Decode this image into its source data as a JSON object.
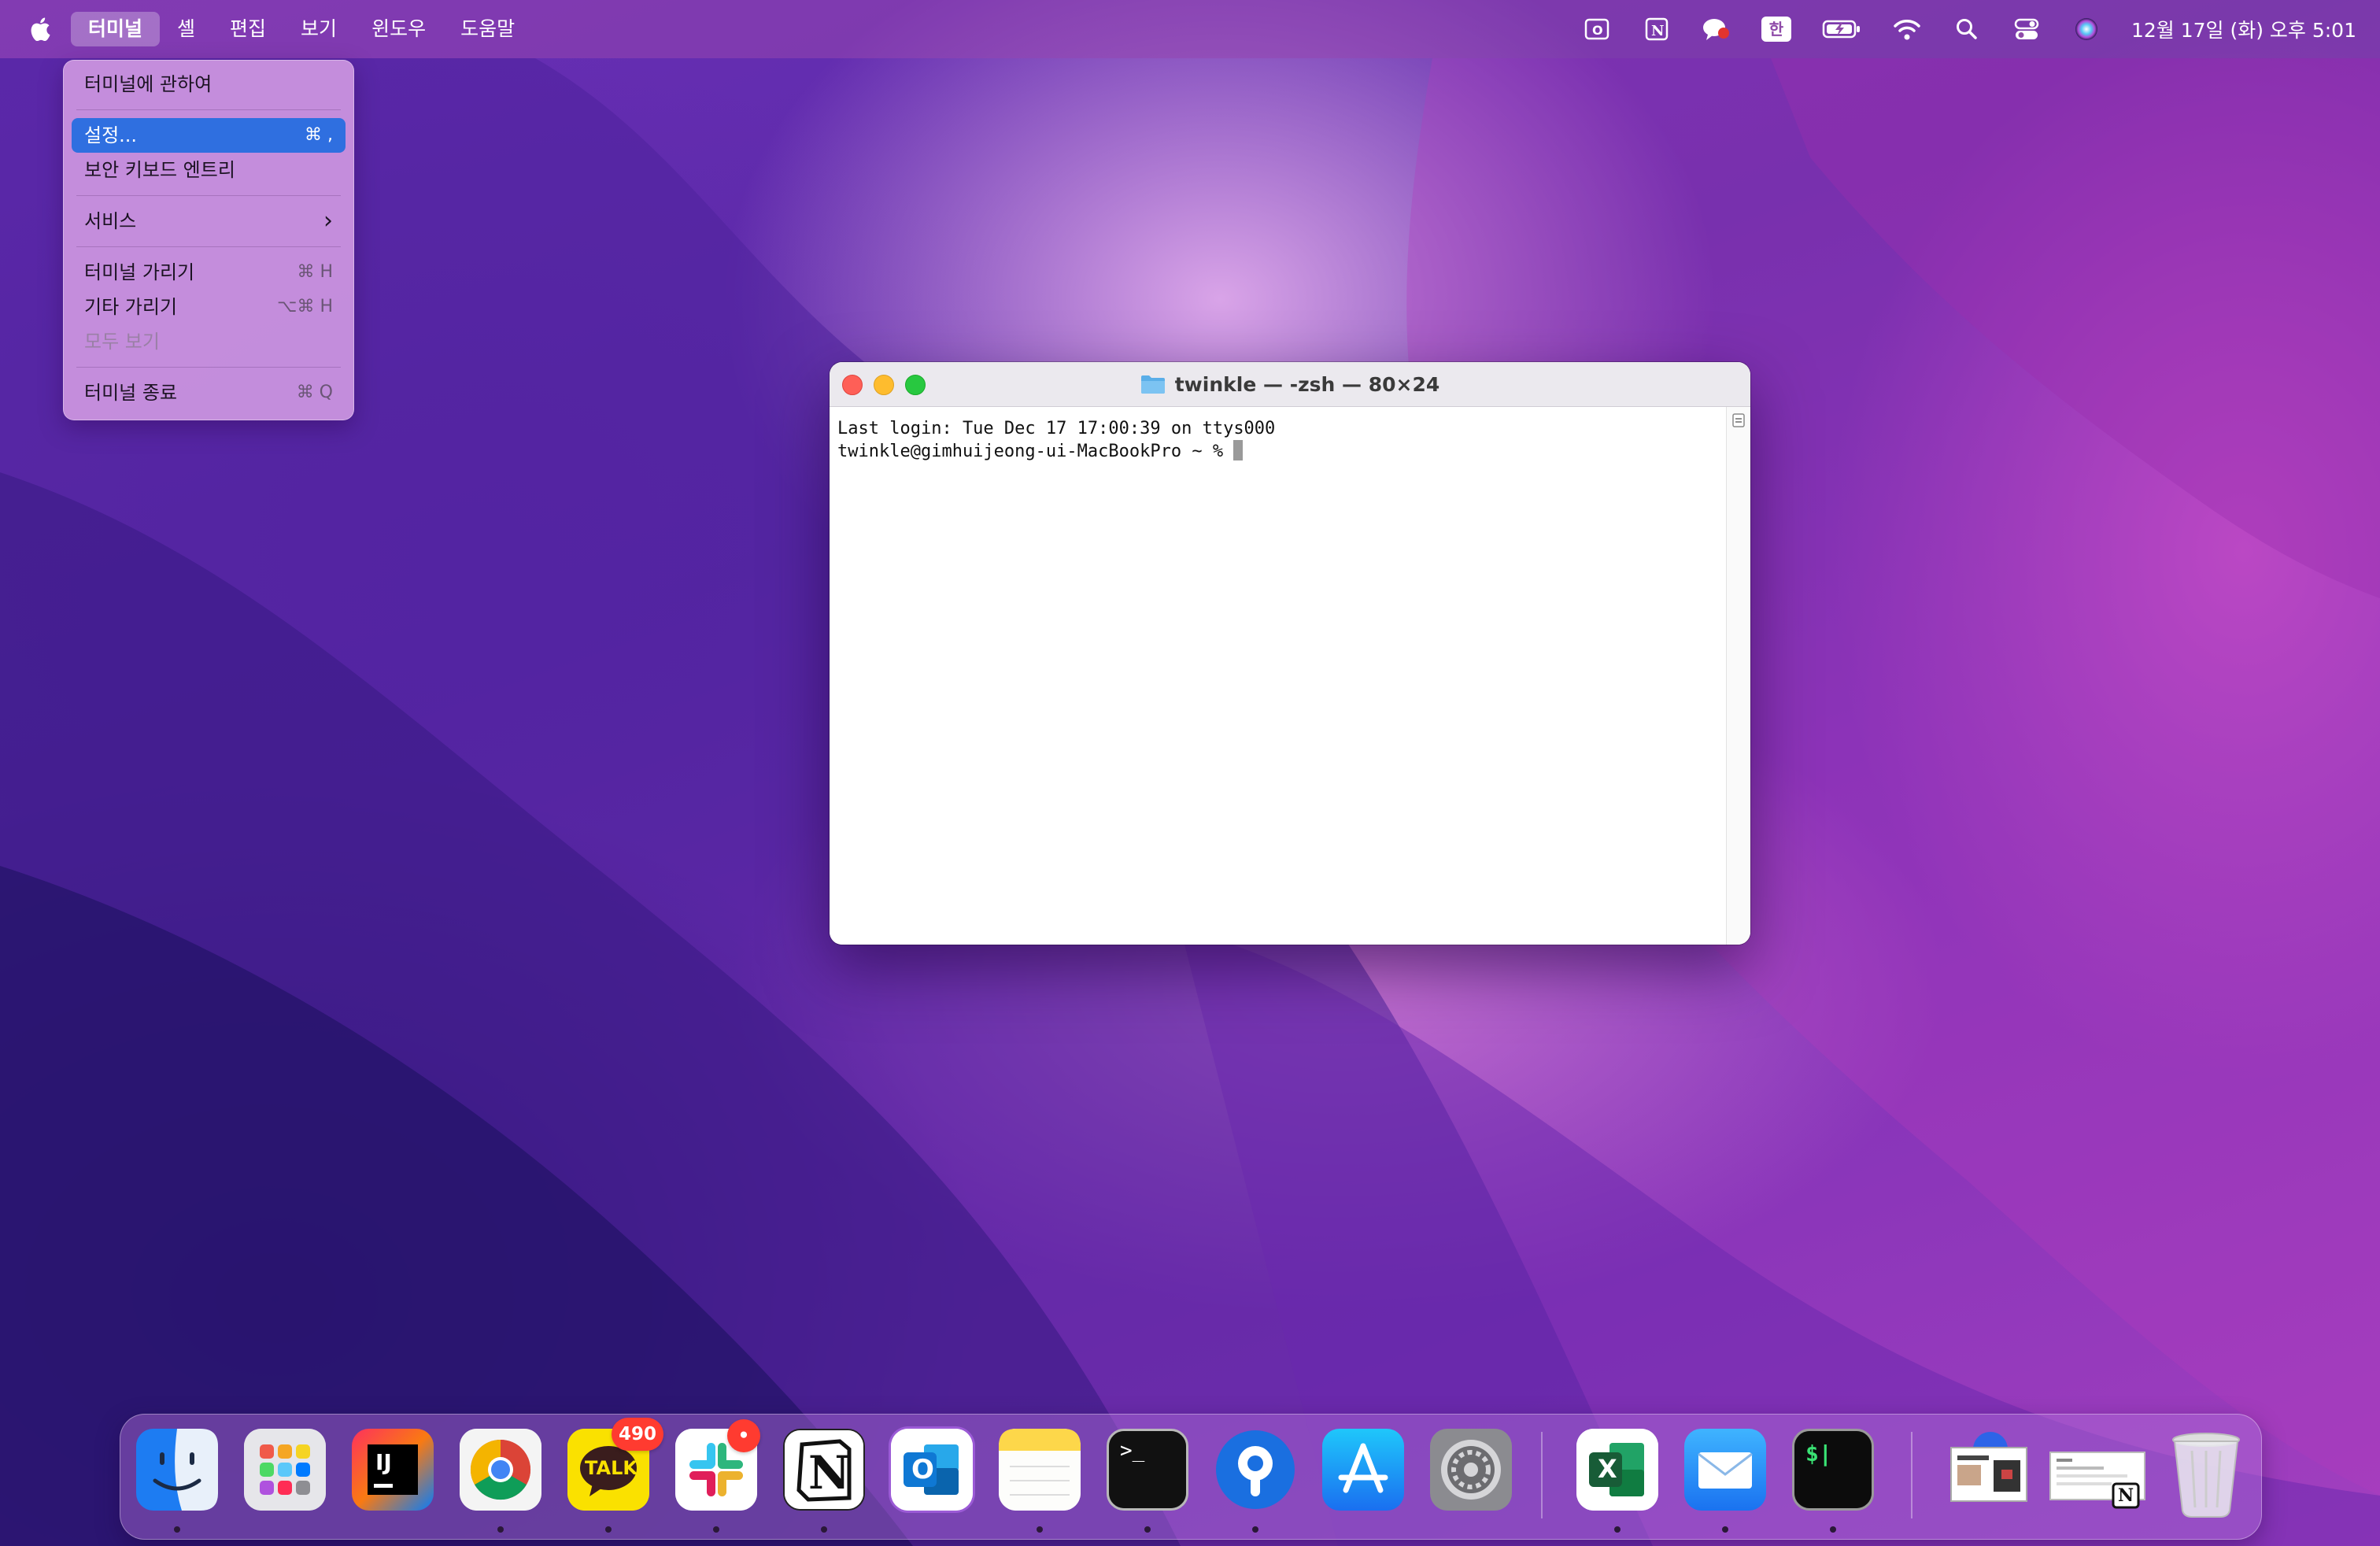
{
  "menubar": {
    "app_name": "터미널",
    "menus": [
      "셸",
      "편집",
      "보기",
      "윈도우",
      "도움말"
    ],
    "clock": "12월 17일 (화) 오후 5:01",
    "input_source": "한"
  },
  "app_menu": {
    "items": [
      {
        "label": "터미널에 관하여",
        "shortcut": ""
      },
      {
        "label": "설정...",
        "shortcut": "⌘ ,"
      },
      {
        "label": "보안 키보드 엔트리",
        "shortcut": ""
      },
      {
        "label": "서비스",
        "shortcut": "›"
      },
      {
        "label": "터미널 가리기",
        "shortcut": "⌘ H"
      },
      {
        "label": "기타 가리기",
        "shortcut": "⌥⌘ H"
      },
      {
        "label": "모두 보기",
        "shortcut": ""
      },
      {
        "label": "터미널 종료",
        "shortcut": "⌘ Q"
      }
    ]
  },
  "terminal": {
    "title": "twinkle — -zsh — 80×24",
    "lines": [
      "Last login: Tue Dec 17 17:00:39 on ttys000",
      "twinkle@gimhuijeong-ui-MacBookPro ~ % "
    ]
  },
  "dock": {
    "items": [
      {
        "name": "Finder",
        "icon": "finder-icon"
      },
      {
        "name": "Launchpad",
        "icon": "launchpad-icon"
      },
      {
        "name": "IntelliJ IDEA",
        "icon": "intellij-icon",
        "label": "IJ"
      },
      {
        "name": "Chrome",
        "icon": "chrome-icon"
      },
      {
        "name": "KakaoTalk",
        "icon": "kakaotalk-icon",
        "label": "TALK",
        "badge": "490"
      },
      {
        "name": "Slack",
        "icon": "slack-icon",
        "badge": "•"
      },
      {
        "name": "Notion",
        "icon": "notion-icon",
        "label": "N"
      },
      {
        "name": "Outlook",
        "icon": "outlook-icon",
        "label": "O"
      },
      {
        "name": "Notes",
        "icon": "notes-icon"
      },
      {
        "name": "Terminal",
        "icon": "terminal-icon",
        "label": ">_"
      },
      {
        "name": "Sourcetree",
        "icon": "sourcetree-icon"
      },
      {
        "name": "App Store",
        "icon": "appstore-icon"
      },
      {
        "name": "System Settings",
        "icon": "settings-icon"
      },
      {
        "name": "Excel",
        "icon": "excel-icon",
        "label": "X"
      },
      {
        "name": "Mail",
        "icon": "mail-icon"
      },
      {
        "name": "iTerm",
        "icon": "iterm-icon",
        "label": "$|"
      },
      {
        "name": "Downloads stack",
        "icon": "downloads-stack-icon"
      },
      {
        "name": "Notion window",
        "icon": "notion-window-thumb-icon",
        "label": "N"
      },
      {
        "name": "Trash",
        "icon": "trash-icon"
      }
    ]
  }
}
